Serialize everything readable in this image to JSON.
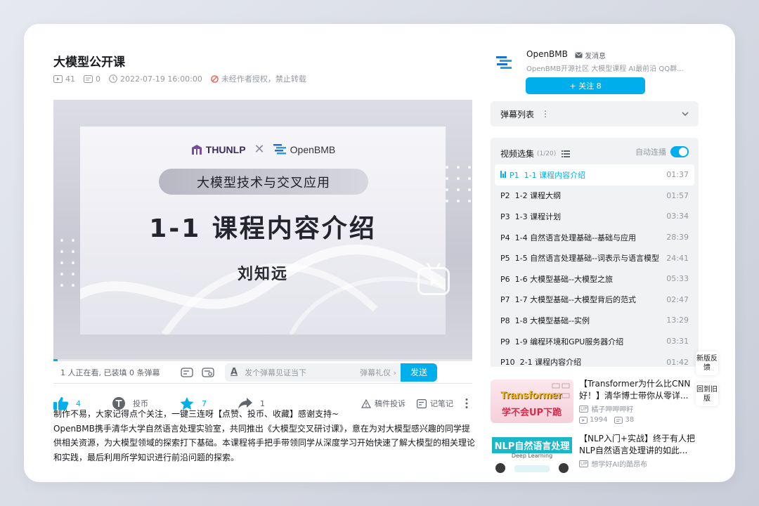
{
  "video": {
    "title": "大模型公开课",
    "views": "41",
    "danmaku_count": "0",
    "datetime": "2022-07-19 16:00:00",
    "copyright": "未经作者授权，禁止转载"
  },
  "slide": {
    "logo_left": "THUNLP",
    "logo_cross": "✕",
    "logo_right": "OpenBMB",
    "pill_text": "大模型技术与交叉应用",
    "lesson": "1-1 课程内容介绍",
    "speaker": "刘知远"
  },
  "player": {
    "progress_fraction": 0.01,
    "accent_color": "#00aeec"
  },
  "danmaku_bar": {
    "viewers": "1 人正在看, 已装填 0 条弹幕",
    "input_placeholder": "发个弹幕见证当下",
    "etiquette": "弹幕礼仪 ›",
    "send": "发送",
    "style_glyph": "A"
  },
  "actions": {
    "like": "4",
    "coin": "投币",
    "favorite": "7",
    "share": "1",
    "report": "稿件投诉",
    "notes": "记笔记"
  },
  "description": {
    "line1": "制作不易，大家记得点个关注，一键三连呀【点赞、投币、收藏】感谢支持~",
    "line2": "OpenBMB携手清华大学自然语言处理实验室，共同推出《大模型交叉研讨课》，意在为对大模型感兴趣的同学提供相关资源，为大模型领域的探索打下基础。本课程将手把手带领同学从深度学习开始快速了解大模型的相关理论和实践，最后利用所学知识进行前沿问题的探索。"
  },
  "up": {
    "name": "OpenBMB",
    "message": "发消息",
    "signature": "OpenBMB开源社区 大模型课程 AI最前沿 QQ群...",
    "follow": "+ 关注 8"
  },
  "danmaku_list": {
    "label": "弹幕列表",
    "more": "⋮",
    "chevron": "⌄"
  },
  "playlist": {
    "title": "视频选集",
    "count": "(1/20)",
    "autoplay": "自动连播",
    "items": [
      {
        "p": "P1",
        "title": "1-1 课程内容介绍",
        "dur": "01:37"
      },
      {
        "p": "P2",
        "title": "1-2 课程大纲",
        "dur": "01:57"
      },
      {
        "p": "P3",
        "title": "1-3 课程计划",
        "dur": "03:34"
      },
      {
        "p": "P4",
        "title": "1-4 自然语言处理基础--基础与应用",
        "dur": "28:39"
      },
      {
        "p": "P5",
        "title": "1-5 自然语言处理基础--词表示与语言模型",
        "dur": "24:41"
      },
      {
        "p": "P6",
        "title": "1-6 大模型基础--大模型之旅",
        "dur": "05:33"
      },
      {
        "p": "P7",
        "title": "1-7 大模型基础--大模型背后的范式",
        "dur": "02:47"
      },
      {
        "p": "P8",
        "title": "1-8 大模型基础--实例",
        "dur": "13:29"
      },
      {
        "p": "P9",
        "title": "1-9 编程环境和GPU服务器介绍",
        "dur": "03:31"
      },
      {
        "p": "P10",
        "title": "2-1 课程内容介绍",
        "dur": "01:42"
      }
    ]
  },
  "side_buttons": {
    "feedback": "新版反馈",
    "old": "回到旧版"
  },
  "recommendations": [
    {
      "thumb_text": "Transformer",
      "thumb_sub": "学不会UP下跪",
      "title": "【Transformer为什么比CNN好！】清华博士带你从零详...",
      "up": "橘子呷呷呷籽",
      "up_badge": "UP",
      "plays": "1994",
      "danmaku": "38"
    },
    {
      "thumb_text": "NLP自然语言处理",
      "thumb_sub": "Deep Learning",
      "title": "【NLP入门+实战】终于有人把NLP自然语言处理讲的如此...",
      "up": "想学好AI的酷昂布",
      "up_badge": "UP"
    }
  ]
}
